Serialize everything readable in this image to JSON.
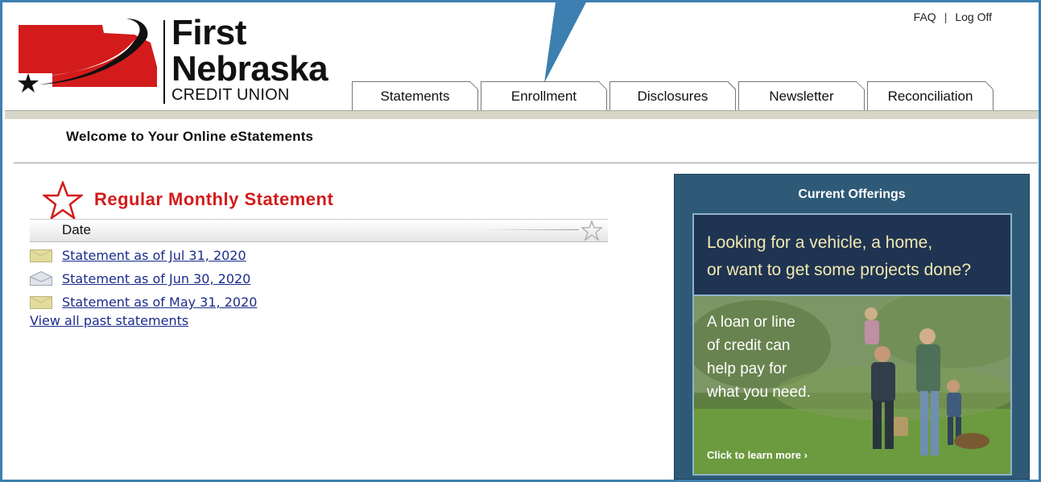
{
  "brand": {
    "line1": "First",
    "line2": "Nebraska",
    "line3": "CREDIT UNION"
  },
  "top_links": {
    "faq": "FAQ",
    "separator": "|",
    "logoff": "Log Off"
  },
  "tabs": [
    {
      "label": "Statements"
    },
    {
      "label": "Enrollment"
    },
    {
      "label": "Disclosures"
    },
    {
      "label": "Newsletter"
    },
    {
      "label": "Reconciliation"
    }
  ],
  "welcome": "Welcome to Your Online eStatements",
  "section": {
    "title": "Regular Monthly Statement",
    "column_header": "Date"
  },
  "statements": [
    {
      "label": "Statement as of Jul 31, 2020",
      "icon": "envelope-closed-icon"
    },
    {
      "label": "Statement as of Jun 30, 2020",
      "icon": "envelope-open-icon"
    },
    {
      "label": "Statement as of May 31, 2020",
      "icon": "envelope-closed-icon"
    }
  ],
  "view_all": "View all past statements",
  "offerings": {
    "title": "Current Offerings",
    "headline_line1": "Looking for a vehicle, a home,",
    "headline_line2": "or want to get some projects done?",
    "body_lines": [
      "A loan or line",
      "of credit can",
      "help pay for",
      "what you need."
    ],
    "cta": "Click to learn more ›"
  },
  "colors": {
    "brand_red": "#d31b1b",
    "frame_blue": "#3d7fb0",
    "link_blue": "#1a2c8a",
    "panel_blue": "#2e5a77"
  }
}
